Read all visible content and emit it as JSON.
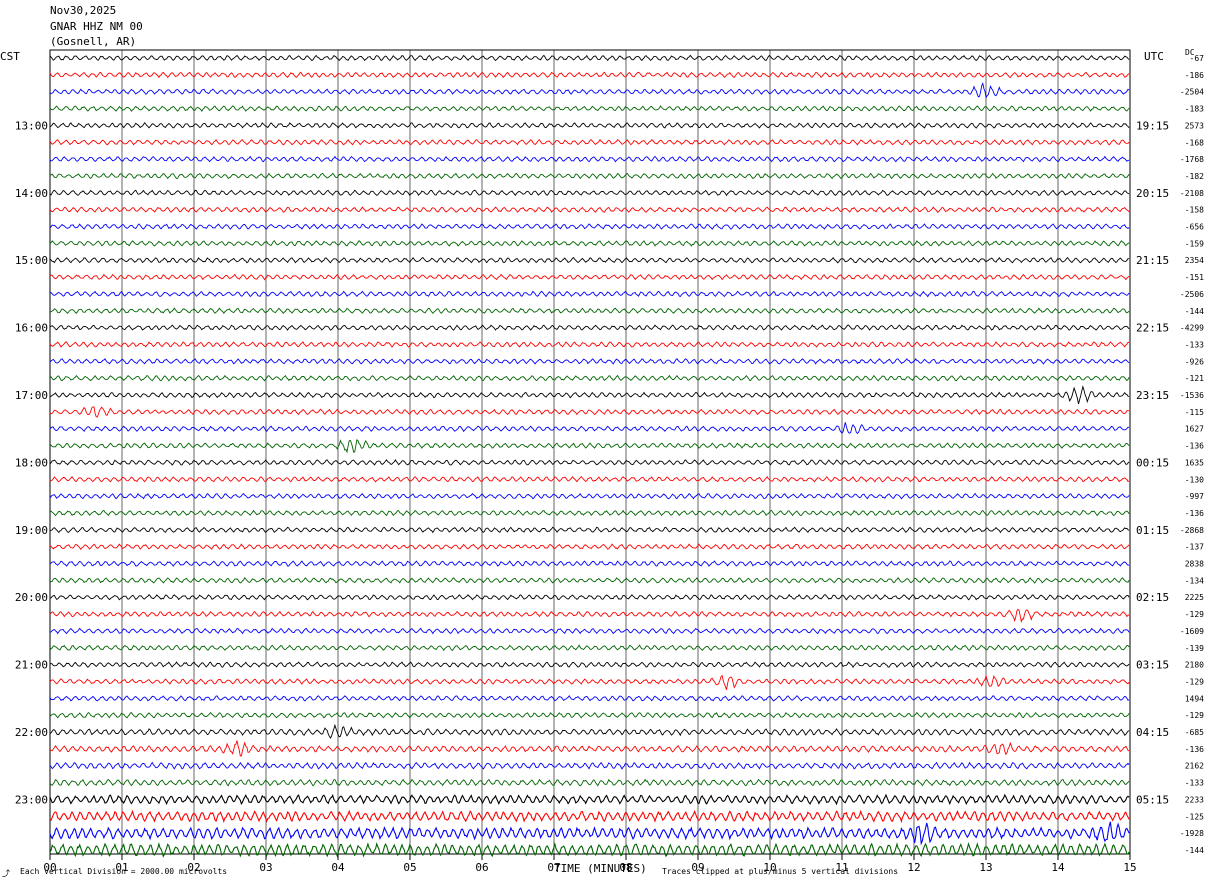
{
  "header": {
    "date": "Nov30,2025",
    "station": "GNAR HHZ NM 00",
    "location": "(Gosnell, AR)"
  },
  "left_timezone": "CST",
  "right_timezone": "UTC",
  "dc_header": "DC",
  "footer": {
    "scale_note": "Each Vertical Division = 2000.00 microvolts",
    "clip_note": "Traces clipped at plus/minus 5 vertical divisions"
  },
  "chart_data": {
    "type": "line",
    "title": "",
    "xlabel": "TIME (MINUTES)",
    "ylabel": "",
    "xlim": [
      0,
      15
    ],
    "x_ticks": [
      "00",
      "01",
      "02",
      "03",
      "04",
      "05",
      "06",
      "07",
      "08",
      "09",
      "10",
      "11",
      "12",
      "13",
      "14",
      "15"
    ],
    "trace_colors": [
      "#000000",
      "#ff0000",
      "#0000ff",
      "#006400"
    ],
    "grid": "vertical lines at each minute",
    "left_hour_labels": [
      "13:00",
      "14:00",
      "15:00",
      "16:00",
      "17:00",
      "18:00",
      "19:00",
      "20:00",
      "21:00",
      "22:00",
      "23:00"
    ],
    "right_hour_labels": [
      "19:15",
      "20:15",
      "21:15",
      "22:15",
      "23:15",
      "00:15",
      "01:15",
      "02:15",
      "03:15",
      "04:15",
      "05:15"
    ],
    "dc_offsets": [
      "-67",
      "-186",
      "-2504",
      "-183",
      "2573",
      "-168",
      "-1768",
      "-182",
      "-2108",
      "-158",
      "-656",
      "-159",
      "2354",
      "-151",
      "-2506",
      "-144",
      "-4299",
      "-133",
      "-926",
      "-121",
      "-1536",
      "-115",
      "1627",
      "-136",
      "1635",
      "-130",
      "-997",
      "-136",
      "-2868",
      "-137",
      "2838",
      "-134",
      "2225",
      "-129",
      "-1609",
      "-139",
      "2180",
      "-129",
      "1494",
      "-129",
      "-685",
      "-136",
      "2162",
      "-133",
      "2233",
      "-125",
      "-1928",
      "-144"
    ],
    "events": [
      {
        "trace": 2,
        "minute": 13.0,
        "amplitude": 2.5
      },
      {
        "trace": 20,
        "minute": 14.3,
        "amplitude": 2.5
      },
      {
        "trace": 21,
        "minute": 0.65,
        "amplitude": 2.0
      },
      {
        "trace": 22,
        "minute": 11.1,
        "amplitude": 2.0
      },
      {
        "trace": 23,
        "minute": 4.2,
        "amplitude": 3.0
      },
      {
        "trace": 33,
        "minute": 13.5,
        "amplitude": 2.5
      },
      {
        "trace": 37,
        "minute": 9.4,
        "amplitude": 2.2
      },
      {
        "trace": 37,
        "minute": 13.1,
        "amplitude": 1.8
      },
      {
        "trace": 40,
        "minute": 4.0,
        "amplitude": 1.8
      },
      {
        "trace": 41,
        "minute": 2.6,
        "amplitude": 2.0
      },
      {
        "trace": 41,
        "minute": 13.2,
        "amplitude": 2.0
      },
      {
        "trace": 46,
        "minute": 12.1,
        "amplitude": 2.5
      },
      {
        "trace": 46,
        "minute": 14.7,
        "amplitude": 2.5
      }
    ]
  }
}
